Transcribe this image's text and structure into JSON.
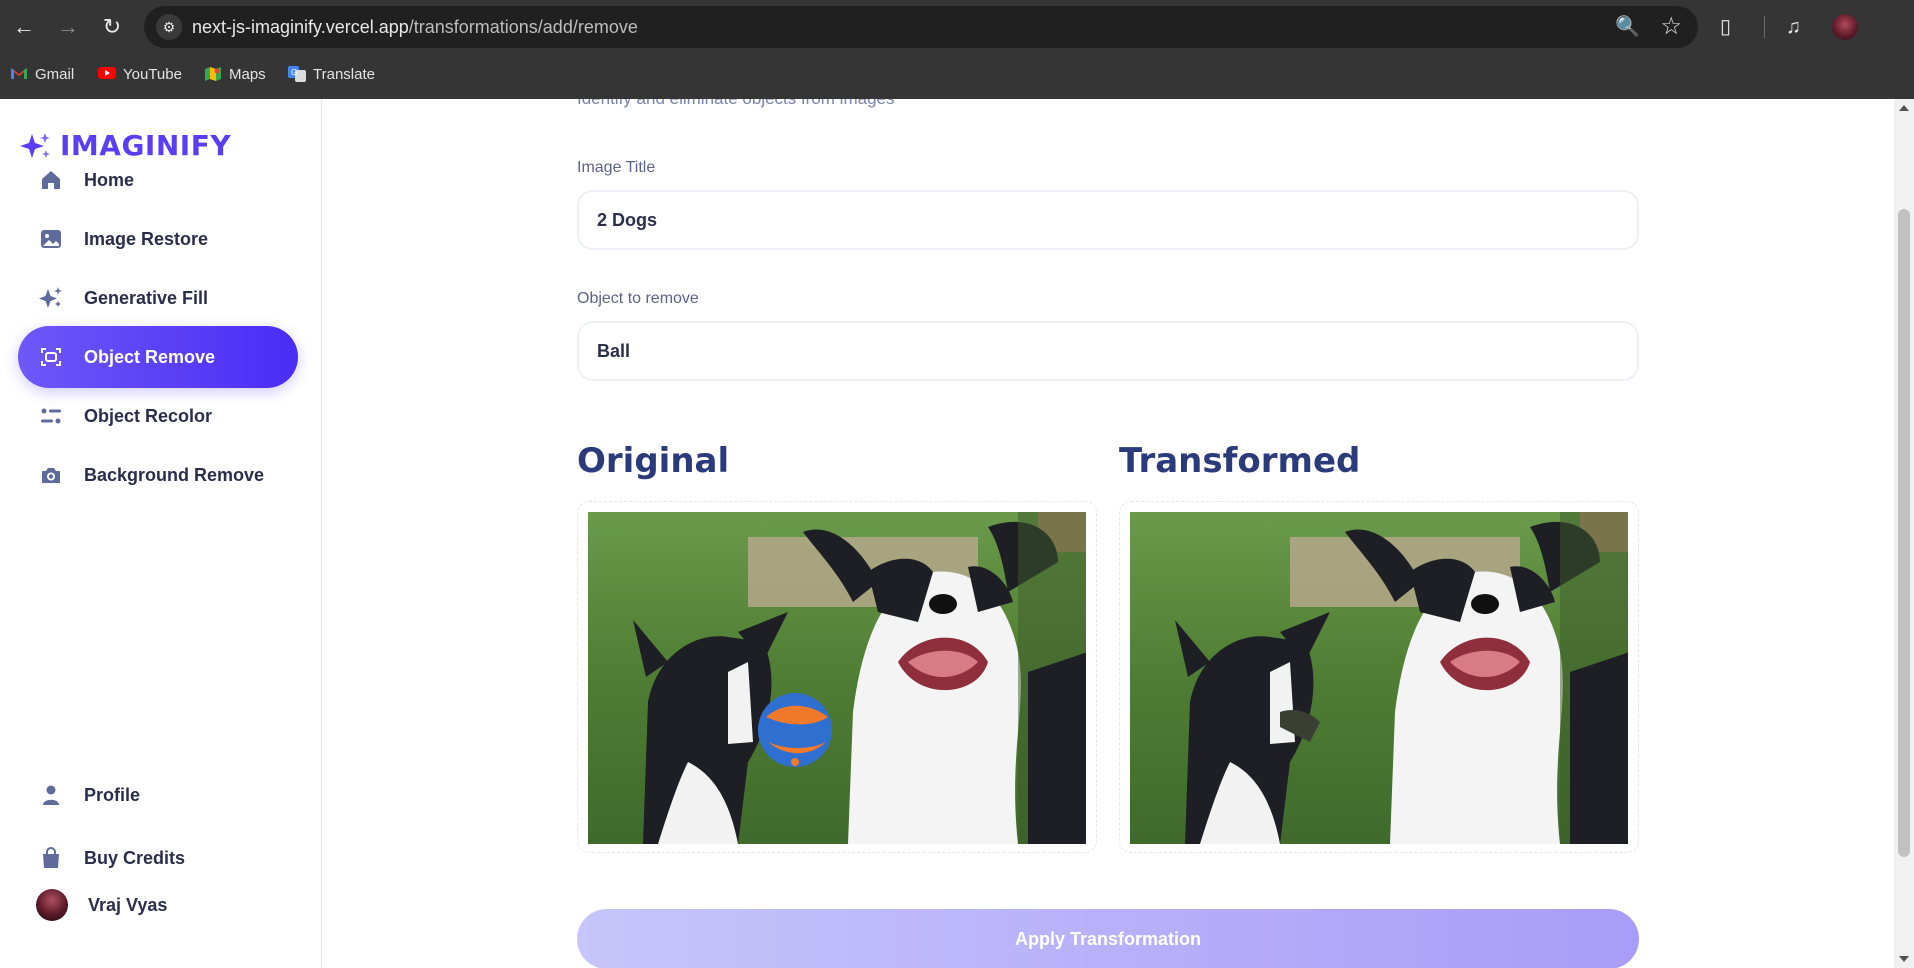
{
  "browser": {
    "url_host": "next-js-imaginify.vercel.app",
    "url_path": "/transformations/add/remove",
    "back_icon": "arrow-left-icon",
    "forward_icon": "arrow-right-icon",
    "reload_icon": "reload-icon",
    "bookmarks": [
      {
        "label": "Gmail",
        "icon": "gmail-icon"
      },
      {
        "label": "YouTube",
        "icon": "youtube-icon"
      },
      {
        "label": "Maps",
        "icon": "maps-icon"
      },
      {
        "label": "Translate",
        "icon": "translate-icon"
      }
    ]
  },
  "sidebar": {
    "logo_text": "IMAGINIFY",
    "items": [
      {
        "label": "Home",
        "icon": "home-icon"
      },
      {
        "label": "Image Restore",
        "icon": "image-icon"
      },
      {
        "label": "Generative Fill",
        "icon": "stars-icon"
      },
      {
        "label": "Object Remove",
        "icon": "scan-icon",
        "active": true
      },
      {
        "label": "Object Recolor",
        "icon": "filter-icon"
      },
      {
        "label": "Background Remove",
        "icon": "camera-icon"
      }
    ],
    "bottom_items": [
      {
        "label": "Profile",
        "icon": "profile-icon"
      },
      {
        "label": "Buy Credits",
        "icon": "bag-icon"
      }
    ],
    "user_name": "Vraj Vyas"
  },
  "main": {
    "subtitle": "Identify and eliminate objects from images",
    "image_title_label": "Image Title",
    "image_title_value": "2 Dogs",
    "object_label": "Object to remove",
    "object_value": "Ball",
    "original_heading": "Original",
    "transformed_heading": "Transformed",
    "apply_button": "Apply Transformation"
  },
  "colors": {
    "accent": "#5b3df5",
    "active_nav": "#4a2cf5",
    "heading": "#2b3a7a",
    "apply_button": "#b7aefa"
  }
}
